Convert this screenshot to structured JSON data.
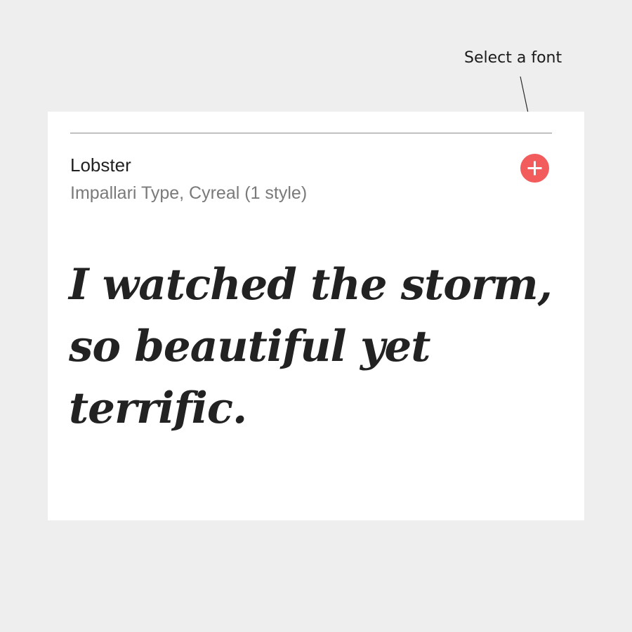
{
  "annotation": {
    "label": "Select a font"
  },
  "font_card": {
    "name": "Lobster",
    "designers": "Impallari Type, Cyreal (1 style)",
    "sample_text": "I watched the storm, so beautiful yet terrific.",
    "add_icon": "plus-icon"
  },
  "colors": {
    "background": "#eeeeee",
    "card": "#ffffff",
    "accent": "#f25c5c",
    "text_primary": "#212121",
    "text_secondary": "#7a7a7a"
  }
}
